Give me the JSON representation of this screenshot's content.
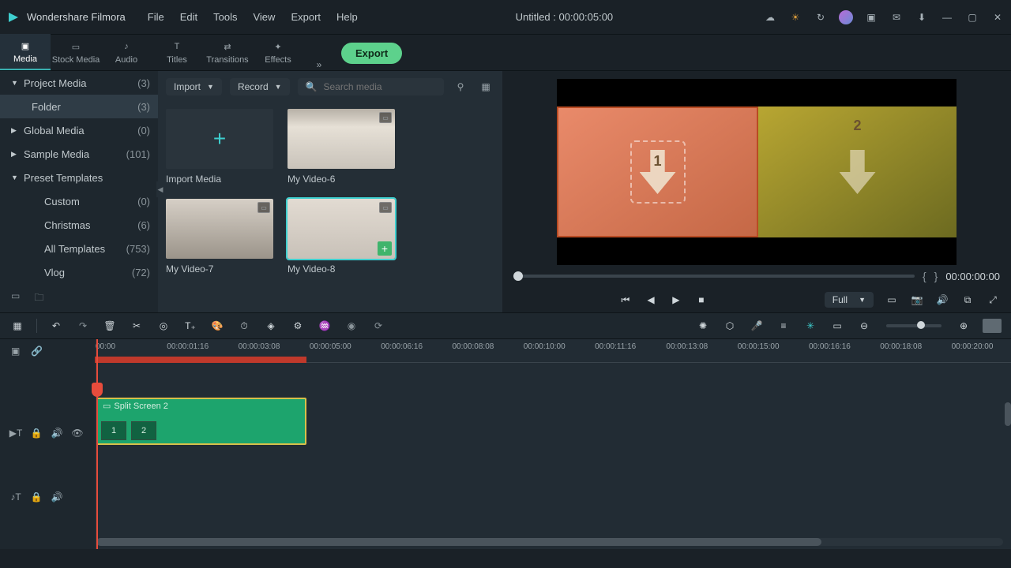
{
  "titlebar": {
    "app_name": "Wondershare Filmora",
    "menus": [
      "File",
      "Edit",
      "Tools",
      "View",
      "Export",
      "Help"
    ],
    "doc_title": "Untitled : 00:00:05:00"
  },
  "top_tabs": {
    "items": [
      "Media",
      "Stock Media",
      "Audio",
      "Titles",
      "Transitions",
      "Effects"
    ],
    "export_label": "Export"
  },
  "sidebar": {
    "items": [
      {
        "label": "Project Media",
        "count": "(3)",
        "expanded": true,
        "level": 0
      },
      {
        "label": "Folder",
        "count": "(3)",
        "level": 1,
        "active": true
      },
      {
        "label": "Global Media",
        "count": "(0)",
        "level": 0,
        "collapsed": true
      },
      {
        "label": "Sample Media",
        "count": "(101)",
        "level": 0,
        "collapsed": true
      },
      {
        "label": "Preset Templates",
        "count": "",
        "level": 0,
        "expanded": true
      },
      {
        "label": "Custom",
        "count": "(0)",
        "level": 1
      },
      {
        "label": "Christmas",
        "count": "(6)",
        "level": 1
      },
      {
        "label": "All Templates",
        "count": "(753)",
        "level": 1
      },
      {
        "label": "Vlog",
        "count": "(72)",
        "level": 1
      }
    ]
  },
  "browser": {
    "import_label": "Import",
    "record_label": "Record",
    "search_placeholder": "Search media",
    "thumbs": [
      {
        "label": "Import Media",
        "kind": "add"
      },
      {
        "label": "My Video-6",
        "kind": "v6"
      },
      {
        "label": "My Video-7",
        "kind": "v7"
      },
      {
        "label": "My Video-8",
        "kind": "v8",
        "selected": true,
        "add": true
      }
    ]
  },
  "preview": {
    "drop_numbers": [
      "1",
      "2"
    ],
    "brackets": {
      "open": "{",
      "close": "}"
    },
    "timecode": "00:00:00:00",
    "full_label": "Full"
  },
  "timeline": {
    "ticks": [
      "00:00",
      "00:00:01:16",
      "00:00:03:08",
      "00:00:05:00",
      "00:00:06:16",
      "00:00:08:08",
      "00:00:10:00",
      "00:00:11:16",
      "00:00:13:08",
      "00:00:15:00",
      "00:00:16:16",
      "00:00:18:08",
      "00:00:20:00"
    ],
    "clip": {
      "title": "Split Screen 2",
      "slots": [
        "1",
        "2"
      ]
    }
  }
}
